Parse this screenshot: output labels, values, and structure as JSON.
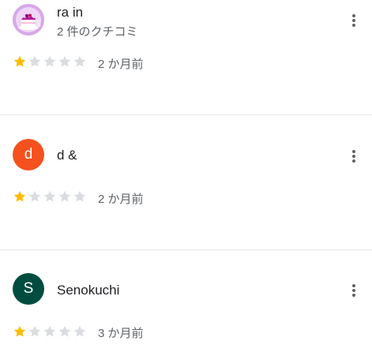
{
  "colors": {
    "star_filled": "#fbbc04",
    "star_empty": "#dadce0",
    "divider": "#e8eaed",
    "name_text": "#202124",
    "meta_text": "#5f6368"
  },
  "reviews": [
    {
      "author": "ra in",
      "subline": "2 件のクチコミ",
      "avatar_type": "photo",
      "avatar_letter": "",
      "avatar_color": "#c58af9",
      "rating": 1,
      "max_rating": 5,
      "time": "2 か月前",
      "menu_icon": "more-vert-icon"
    },
    {
      "author": "d &",
      "subline": "",
      "avatar_type": "letter",
      "avatar_letter": "d",
      "avatar_color": "#f4511e",
      "rating": 1,
      "max_rating": 5,
      "time": "2 か月前",
      "menu_icon": "more-vert-icon"
    },
    {
      "author": "Senokuchi",
      "subline": "",
      "avatar_type": "letter",
      "avatar_letter": "S",
      "avatar_color": "#004d40",
      "rating": 1,
      "max_rating": 5,
      "time": "3 か月前",
      "menu_icon": "more-vert-icon"
    }
  ]
}
